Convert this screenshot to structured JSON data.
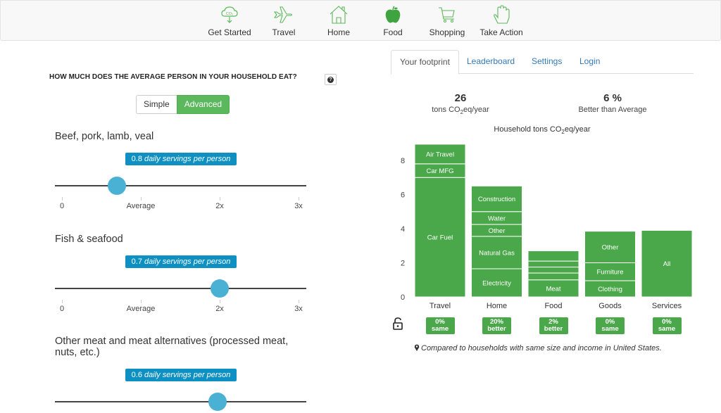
{
  "nav": {
    "items": [
      {
        "label": "Get Started",
        "icon": "co2-cloud-icon",
        "active": false
      },
      {
        "label": "Travel",
        "icon": "airplane-icon",
        "active": false
      },
      {
        "label": "Home",
        "icon": "house-icon",
        "active": false
      },
      {
        "label": "Food",
        "icon": "apple-icon",
        "active": true
      },
      {
        "label": "Shopping",
        "icon": "cart-icon",
        "active": false
      },
      {
        "label": "Take Action",
        "icon": "hand-icon",
        "active": false
      }
    ]
  },
  "left": {
    "question": "HOW MUCH DOES THE AVERAGE PERSON IN YOUR HOUSEHOLD EAT?",
    "help_icon": "?",
    "mode_toggle": {
      "simple": "Simple",
      "advanced": "Advanced",
      "selected": "Advanced"
    },
    "tick_labels": [
      "0",
      "Average",
      "2x",
      "3x"
    ],
    "food_items": [
      {
        "title": "Beef, pork, lamb, veal",
        "value": "0.8",
        "unit": "daily servings per person",
        "level_x_average": 0.7
      },
      {
        "title": "Fish & seafood",
        "value": "0.7",
        "unit": "daily servings per person",
        "level_x_average": 2.0
      },
      {
        "title": "Other meat and meat alternatives (processed meat, nuts, etc.)",
        "value": "0.6",
        "unit": "daily servings per person",
        "level_x_average": 1.97
      }
    ]
  },
  "right": {
    "tabs": [
      {
        "label": "Your footprint",
        "active": true
      },
      {
        "label": "Leaderboard",
        "active": false
      },
      {
        "label": "Settings",
        "active": false
      },
      {
        "label": "Login",
        "active": false
      }
    ],
    "stats": [
      {
        "value": "26",
        "label_pre": "tons CO",
        "label_sub": "2",
        "label_post": "eq/year"
      },
      {
        "value": "6 %",
        "label": "Better than Average"
      }
    ],
    "chart_title_pre": "Household tons CO",
    "chart_title_sub": "2",
    "chart_title_post": "eq/year",
    "comparison_badges": [
      {
        "pct": "0%",
        "word": "same"
      },
      {
        "pct": "20%",
        "word": "better"
      },
      {
        "pct": "2%",
        "word": "better"
      },
      {
        "pct": "0%",
        "word": "same"
      },
      {
        "pct": "0%",
        "word": "same"
      }
    ],
    "footnote": "Compared to households with same size and income in United States.",
    "colors": {
      "bar": "#4aa84a",
      "badge": "#4aa84a",
      "accent": "#5cb85c",
      "link": "#337ab7",
      "slider_bubble": "#0e90c3",
      "slider_handle": "#4ab0d4"
    }
  },
  "chart_data": {
    "type": "bar",
    "stacked": true,
    "title": "Household tons CO2eq/year",
    "xlabel": "",
    "ylabel": "",
    "ylim": [
      0,
      9
    ],
    "yticks": [
      0,
      2,
      4,
      6,
      8
    ],
    "categories": [
      "Travel",
      "Home",
      "Food",
      "Goods",
      "Services"
    ],
    "stacks": [
      {
        "category": "Travel",
        "segments": [
          {
            "name": "Car Fuel",
            "value": 7.0
          },
          {
            "name": "Car MFG",
            "value": 0.8
          },
          {
            "name": "Air Travel",
            "value": 1.15
          }
        ]
      },
      {
        "category": "Home",
        "segments": [
          {
            "name": "Electricity",
            "value": 1.65
          },
          {
            "name": "Natural Gas",
            "value": 1.9
          },
          {
            "name": "Other",
            "value": 0.7
          },
          {
            "name": "Water",
            "value": 0.75
          },
          {
            "name": "Construction",
            "value": 1.5
          }
        ]
      },
      {
        "category": "Food",
        "segments": [
          {
            "name": "Meat",
            "value": 1.0
          },
          {
            "name": "",
            "value": 0.4
          },
          {
            "name": "",
            "value": 0.35
          },
          {
            "name": "",
            "value": 0.35
          },
          {
            "name": "",
            "value": 0.6
          }
        ]
      },
      {
        "category": "Goods",
        "segments": [
          {
            "name": "Clothing",
            "value": 0.95
          },
          {
            "name": "Furniture",
            "value": 1.05
          },
          {
            "name": "Other",
            "value": 1.85
          }
        ]
      },
      {
        "category": "Services",
        "segments": [
          {
            "name": "All",
            "value": 3.9
          }
        ]
      }
    ]
  }
}
